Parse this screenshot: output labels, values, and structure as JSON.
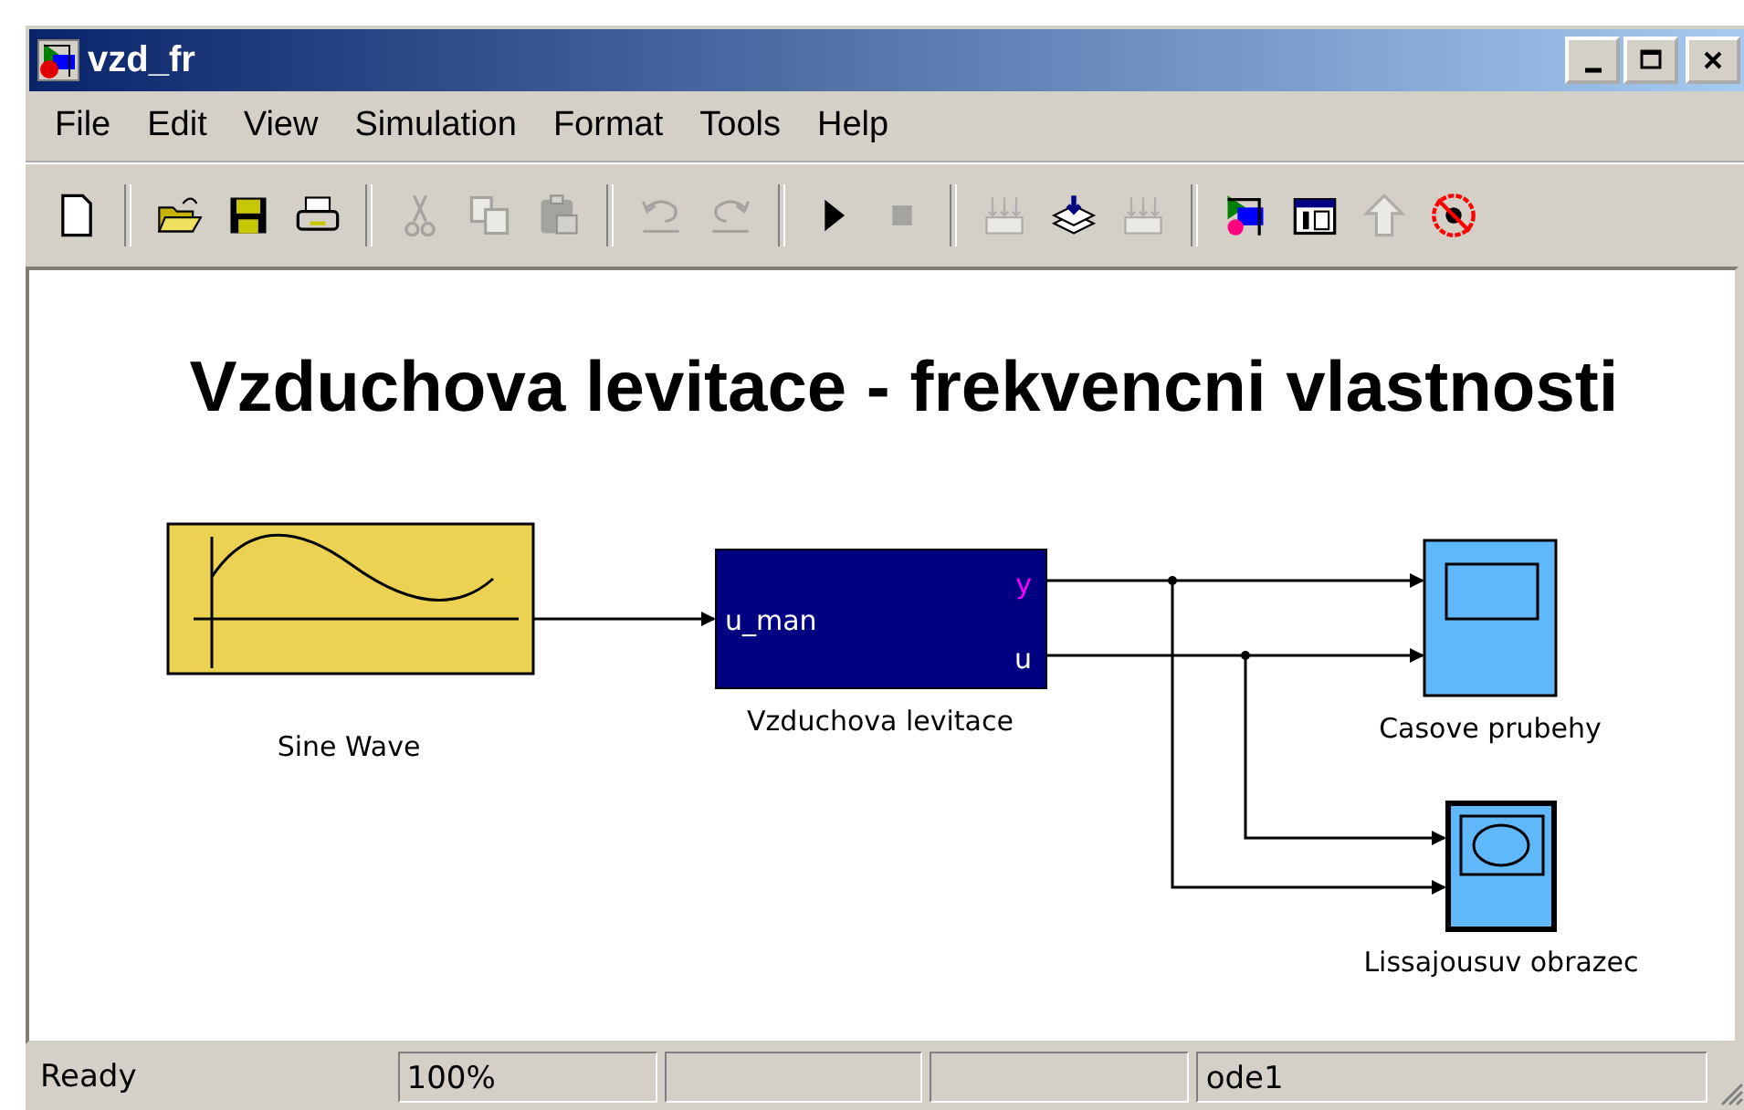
{
  "window": {
    "title": "vzd_fr"
  },
  "menu": [
    {
      "label": "File"
    },
    {
      "label": "Edit"
    },
    {
      "label": "View"
    },
    {
      "label": "Simulation"
    },
    {
      "label": "Format"
    },
    {
      "label": "Tools"
    },
    {
      "label": "Help"
    }
  ],
  "toolbar": [
    {
      "kind": "new",
      "disabled": false
    },
    {
      "kind": "separator"
    },
    {
      "kind": "open",
      "disabled": false
    },
    {
      "kind": "save",
      "disabled": false
    },
    {
      "kind": "print",
      "disabled": false
    },
    {
      "kind": "separator"
    },
    {
      "kind": "cut",
      "disabled": true
    },
    {
      "kind": "copy",
      "disabled": true
    },
    {
      "kind": "paste",
      "disabled": true
    },
    {
      "kind": "separator"
    },
    {
      "kind": "undo",
      "disabled": true
    },
    {
      "kind": "redo",
      "disabled": true
    },
    {
      "kind": "separator"
    },
    {
      "kind": "start",
      "disabled": false
    },
    {
      "kind": "stop",
      "disabled": true
    },
    {
      "kind": "separator"
    },
    {
      "kind": "build",
      "disabled": true
    },
    {
      "kind": "update",
      "disabled": false
    },
    {
      "kind": "build",
      "disabled": true
    },
    {
      "kind": "separator"
    },
    {
      "kind": "library",
      "disabled": false
    },
    {
      "kind": "browser",
      "disabled": false
    },
    {
      "kind": "up",
      "disabled": true
    },
    {
      "kind": "debug",
      "disabled": false
    }
  ],
  "diagram": {
    "title": "Vzduchova levitace - frekvencni vlastnosti",
    "blocks": [
      {
        "kind": "sine",
        "label": "Sine Wave"
      },
      {
        "kind": "subsystem",
        "label": "Vzduchova levitace",
        "inputs": [
          "u_man"
        ],
        "outputs": [
          {
            "label": "y",
            "color": "#ff00ff"
          },
          {
            "label": "u",
            "color": "#ffffff"
          }
        ]
      },
      {
        "kind": "scope",
        "label": "Casove prubehy"
      },
      {
        "kind": "xy-graph",
        "label": "Lissajousuv obrazec"
      }
    ]
  },
  "status_bar": {
    "message": "Ready",
    "zoom": "100%",
    "solver": "ode1"
  }
}
